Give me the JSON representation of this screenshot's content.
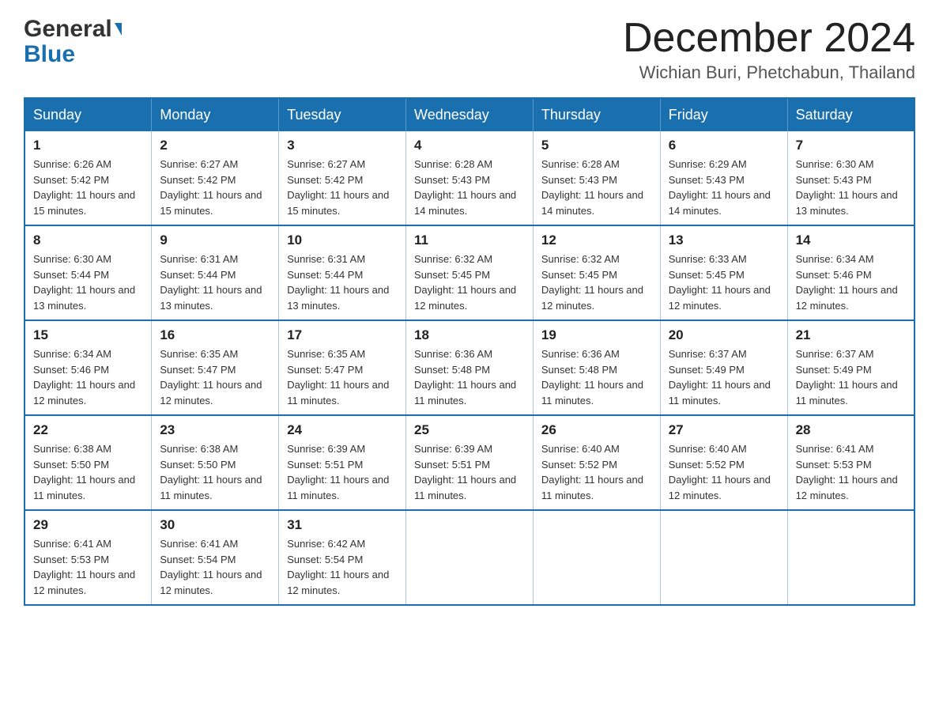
{
  "header": {
    "logo": {
      "general_text": "General",
      "blue_text": "Blue",
      "alt": "GeneralBlue logo"
    },
    "title": "December 2024",
    "location": "Wichian Buri, Phetchabun, Thailand"
  },
  "calendar": {
    "days_of_week": [
      "Sunday",
      "Monday",
      "Tuesday",
      "Wednesday",
      "Thursday",
      "Friday",
      "Saturday"
    ],
    "weeks": [
      [
        {
          "day": "1",
          "sunrise": "6:26 AM",
          "sunset": "5:42 PM",
          "daylight": "11 hours and 15 minutes."
        },
        {
          "day": "2",
          "sunrise": "6:27 AM",
          "sunset": "5:42 PM",
          "daylight": "11 hours and 15 minutes."
        },
        {
          "day": "3",
          "sunrise": "6:27 AM",
          "sunset": "5:42 PM",
          "daylight": "11 hours and 15 minutes."
        },
        {
          "day": "4",
          "sunrise": "6:28 AM",
          "sunset": "5:43 PM",
          "daylight": "11 hours and 14 minutes."
        },
        {
          "day": "5",
          "sunrise": "6:28 AM",
          "sunset": "5:43 PM",
          "daylight": "11 hours and 14 minutes."
        },
        {
          "day": "6",
          "sunrise": "6:29 AM",
          "sunset": "5:43 PM",
          "daylight": "11 hours and 14 minutes."
        },
        {
          "day": "7",
          "sunrise": "6:30 AM",
          "sunset": "5:43 PM",
          "daylight": "11 hours and 13 minutes."
        }
      ],
      [
        {
          "day": "8",
          "sunrise": "6:30 AM",
          "sunset": "5:44 PM",
          "daylight": "11 hours and 13 minutes."
        },
        {
          "day": "9",
          "sunrise": "6:31 AM",
          "sunset": "5:44 PM",
          "daylight": "11 hours and 13 minutes."
        },
        {
          "day": "10",
          "sunrise": "6:31 AM",
          "sunset": "5:44 PM",
          "daylight": "11 hours and 13 minutes."
        },
        {
          "day": "11",
          "sunrise": "6:32 AM",
          "sunset": "5:45 PM",
          "daylight": "11 hours and 12 minutes."
        },
        {
          "day": "12",
          "sunrise": "6:32 AM",
          "sunset": "5:45 PM",
          "daylight": "11 hours and 12 minutes."
        },
        {
          "day": "13",
          "sunrise": "6:33 AM",
          "sunset": "5:45 PM",
          "daylight": "11 hours and 12 minutes."
        },
        {
          "day": "14",
          "sunrise": "6:34 AM",
          "sunset": "5:46 PM",
          "daylight": "11 hours and 12 minutes."
        }
      ],
      [
        {
          "day": "15",
          "sunrise": "6:34 AM",
          "sunset": "5:46 PM",
          "daylight": "11 hours and 12 minutes."
        },
        {
          "day": "16",
          "sunrise": "6:35 AM",
          "sunset": "5:47 PM",
          "daylight": "11 hours and 12 minutes."
        },
        {
          "day": "17",
          "sunrise": "6:35 AM",
          "sunset": "5:47 PM",
          "daylight": "11 hours and 11 minutes."
        },
        {
          "day": "18",
          "sunrise": "6:36 AM",
          "sunset": "5:48 PM",
          "daylight": "11 hours and 11 minutes."
        },
        {
          "day": "19",
          "sunrise": "6:36 AM",
          "sunset": "5:48 PM",
          "daylight": "11 hours and 11 minutes."
        },
        {
          "day": "20",
          "sunrise": "6:37 AM",
          "sunset": "5:49 PM",
          "daylight": "11 hours and 11 minutes."
        },
        {
          "day": "21",
          "sunrise": "6:37 AM",
          "sunset": "5:49 PM",
          "daylight": "11 hours and 11 minutes."
        }
      ],
      [
        {
          "day": "22",
          "sunrise": "6:38 AM",
          "sunset": "5:50 PM",
          "daylight": "11 hours and 11 minutes."
        },
        {
          "day": "23",
          "sunrise": "6:38 AM",
          "sunset": "5:50 PM",
          "daylight": "11 hours and 11 minutes."
        },
        {
          "day": "24",
          "sunrise": "6:39 AM",
          "sunset": "5:51 PM",
          "daylight": "11 hours and 11 minutes."
        },
        {
          "day": "25",
          "sunrise": "6:39 AM",
          "sunset": "5:51 PM",
          "daylight": "11 hours and 11 minutes."
        },
        {
          "day": "26",
          "sunrise": "6:40 AM",
          "sunset": "5:52 PM",
          "daylight": "11 hours and 11 minutes."
        },
        {
          "day": "27",
          "sunrise": "6:40 AM",
          "sunset": "5:52 PM",
          "daylight": "11 hours and 12 minutes."
        },
        {
          "day": "28",
          "sunrise": "6:41 AM",
          "sunset": "5:53 PM",
          "daylight": "11 hours and 12 minutes."
        }
      ],
      [
        {
          "day": "29",
          "sunrise": "6:41 AM",
          "sunset": "5:53 PM",
          "daylight": "11 hours and 12 minutes."
        },
        {
          "day": "30",
          "sunrise": "6:41 AM",
          "sunset": "5:54 PM",
          "daylight": "11 hours and 12 minutes."
        },
        {
          "day": "31",
          "sunrise": "6:42 AM",
          "sunset": "5:54 PM",
          "daylight": "11 hours and 12 minutes."
        },
        null,
        null,
        null,
        null
      ]
    ]
  }
}
